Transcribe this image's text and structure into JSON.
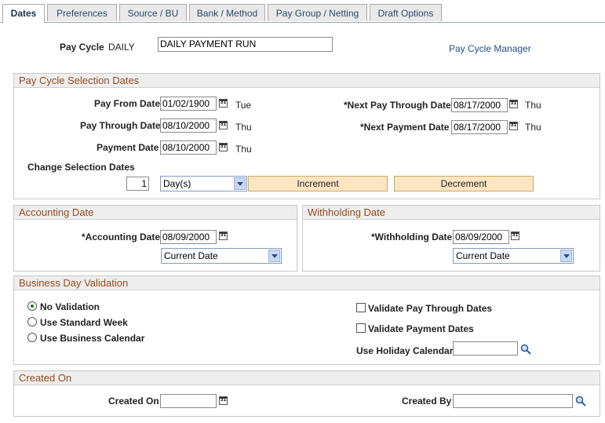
{
  "tabs": [
    {
      "label": "Dates",
      "active": true
    },
    {
      "label": "Preferences"
    },
    {
      "label": "Source / BU"
    },
    {
      "label": "Bank / Method"
    },
    {
      "label": "Pay Group / Netting"
    },
    {
      "label": "Draft Options"
    }
  ],
  "header": {
    "pay_cycle_label": "Pay Cycle",
    "pay_cycle_value": "DAILY",
    "description_value": "DAILY PAYMENT RUN",
    "manager_link": "Pay Cycle Manager"
  },
  "selection": {
    "title": "Pay Cycle Selection Dates",
    "pay_from_label": "Pay From Date",
    "pay_from_value": "01/02/1900",
    "pay_from_day": "Tue",
    "pay_through_label": "Pay Through Date",
    "pay_through_value": "08/10/2000",
    "pay_through_day": "Thu",
    "payment_label": "Payment Date",
    "payment_value": "08/10/2000",
    "payment_day": "Thu",
    "next_through_label": "*Next Pay Through Date",
    "next_through_value": "08/17/2000",
    "next_through_day": "Thu",
    "next_payment_label": "*Next Payment Date",
    "next_payment_value": "08/17/2000",
    "next_payment_day": "Thu",
    "change_label": "Change Selection Dates",
    "change_qty": "1",
    "change_unit": "Day(s)",
    "increment_label": "Increment",
    "decrement_label": "Decrement"
  },
  "accounting": {
    "title": "Accounting Date",
    "date_label": "*Accounting Date",
    "date_value": "08/09/2000",
    "option": "Current Date"
  },
  "withholding": {
    "title": "Withholding Date",
    "date_label": "*Withholding Date",
    "date_value": "08/09/2000",
    "option": "Current Date"
  },
  "business": {
    "title": "Business Day Validation",
    "no_validation": "No Validation",
    "standard_week": "Use Standard Week",
    "business_calendar": "Use Business Calendar",
    "validate_through": "Validate Pay Through Dates",
    "validate_payment": "Validate Payment Dates",
    "holiday_label": "Use Holiday Calendar",
    "holiday_value": ""
  },
  "created": {
    "title": "Created On",
    "on_label": "Created On",
    "on_value": "",
    "by_label": "Created By",
    "by_value": ""
  },
  "calendar_icon_glyph": "31",
  "colors": {
    "section_title": "#9c4a1c",
    "button_fill": "#fde5c2",
    "link": "#1d4e8a"
  }
}
